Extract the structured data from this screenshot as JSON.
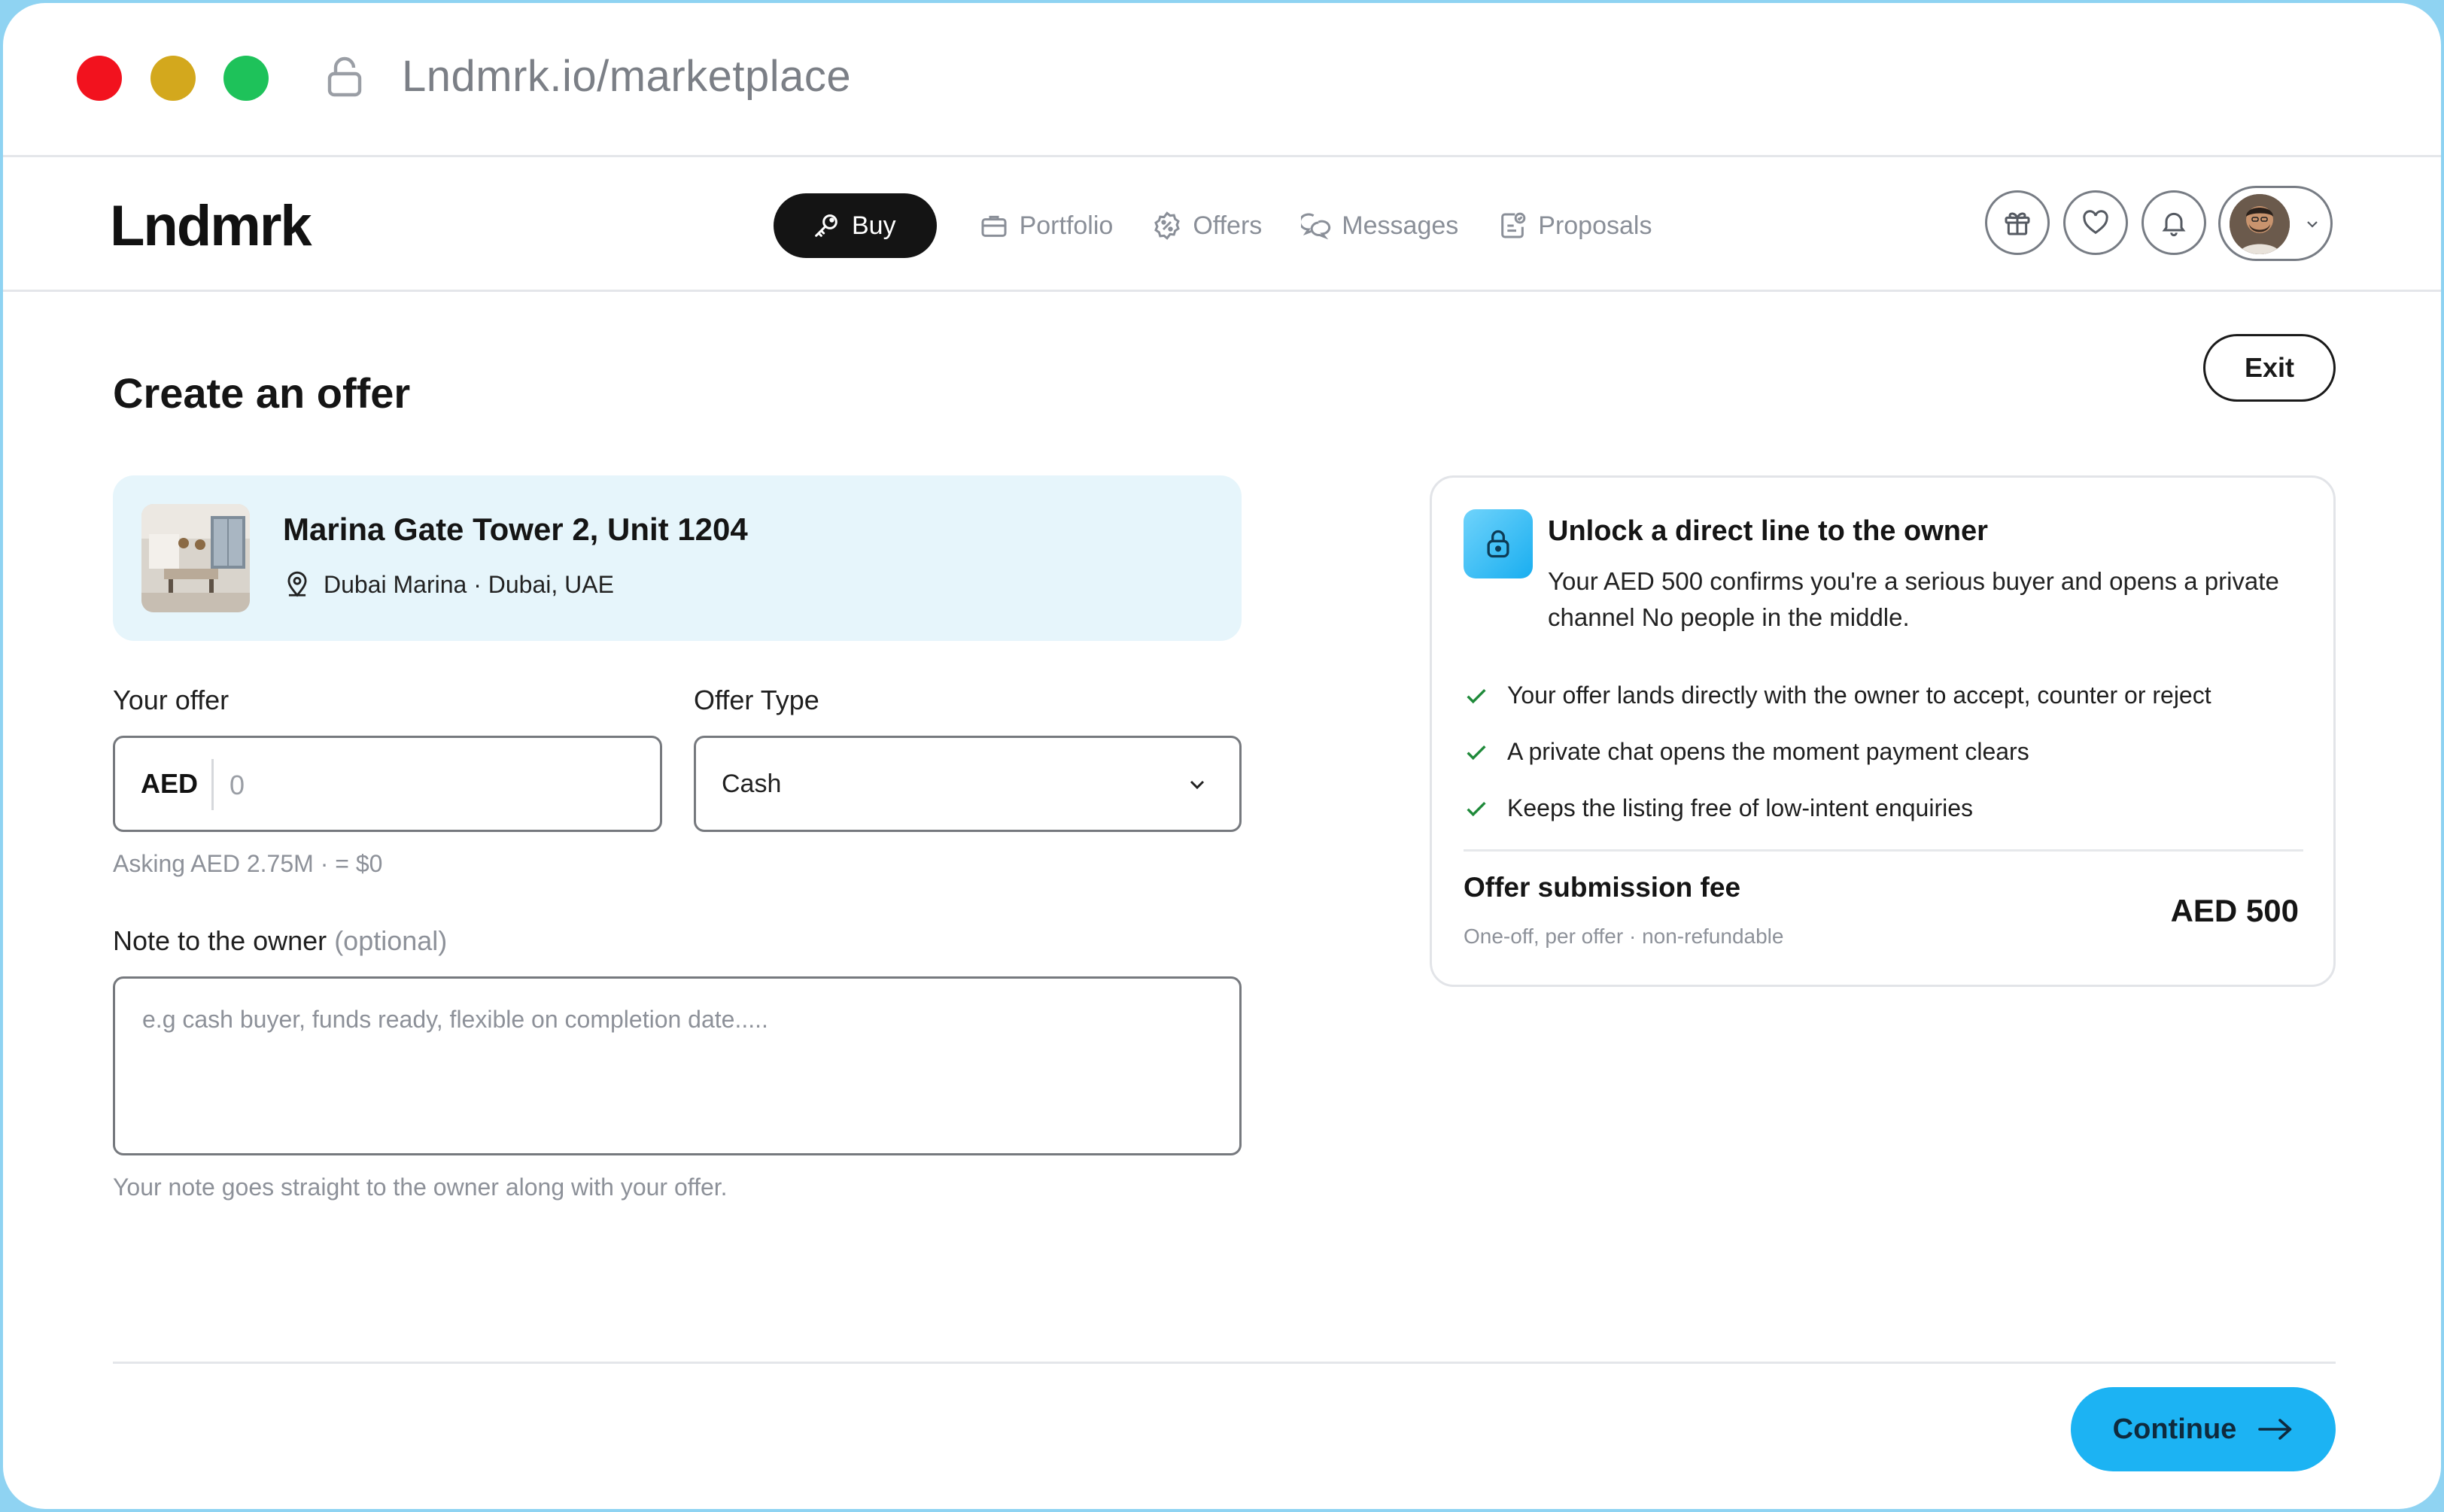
{
  "browser": {
    "url": "Lndmrk.io/marketplace"
  },
  "header": {
    "logo": "Lndmrk",
    "nav": [
      {
        "label": "Buy",
        "icon": "key-icon",
        "active": true
      },
      {
        "label": "Portfolio",
        "icon": "briefcase-icon",
        "active": false
      },
      {
        "label": "Offers",
        "icon": "percent-badge-icon",
        "active": false
      },
      {
        "label": "Messages",
        "icon": "chat-bubbles-icon",
        "active": false
      },
      {
        "label": "Proposals",
        "icon": "document-check-icon",
        "active": false
      }
    ],
    "actions": [
      "gift-icon",
      "heart-icon",
      "bell-icon"
    ],
    "profile_icon": "chevron-down-icon"
  },
  "page": {
    "title": "Create an offer",
    "exit_label": "Exit"
  },
  "property": {
    "title": "Marina Gate Tower 2, Unit 1204",
    "location": "Dubai Marina · Dubai, UAE"
  },
  "form": {
    "offer_label": "Your offer",
    "currency": "AED",
    "offer_value": "",
    "offer_placeholder": "0",
    "offer_type_label": "Offer Type",
    "offer_type_value": "Cash",
    "asking_hint": "Asking AED 2.75M · = $0",
    "note_label": "Note to the owner",
    "note_optional": "(optional)",
    "note_placeholder": "e.g cash buyer, funds ready, flexible on completion date.....",
    "note_hint": "Your note goes straight to the owner along with your offer."
  },
  "info": {
    "title": "Unlock a direct line to the owner",
    "description": "Your AED 500 confirms you're a serious buyer and opens a private channel No people in the middle.",
    "benefits": [
      "Your offer lands directly with the owner to accept, counter or reject",
      "A private chat opens the moment payment clears",
      "Keeps the listing free of low-intent enquiries"
    ],
    "fee_label": "Offer submission fee",
    "fee_sub": "One-off, per offer · non-refundable",
    "fee_amount": "AED 500"
  },
  "footer": {
    "continue_label": "Continue"
  },
  "colors": {
    "accent": "#1cb3f3",
    "card_tint": "#e6f5fb",
    "check": "#1f8a3a",
    "nav_active": "#141414"
  }
}
